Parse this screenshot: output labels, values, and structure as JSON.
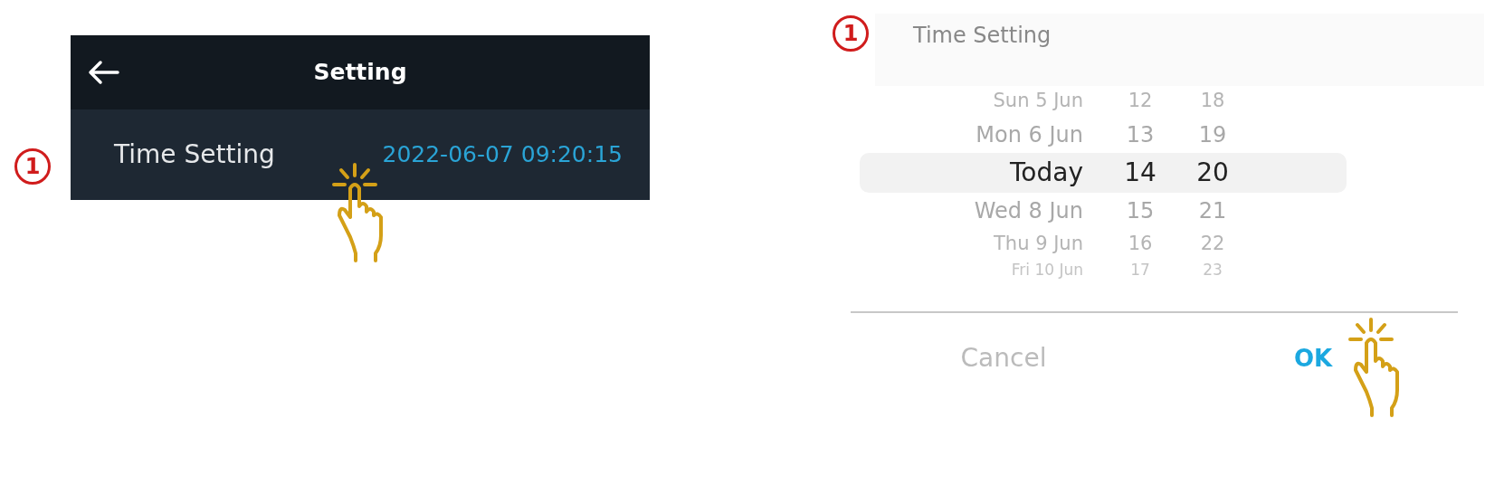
{
  "setting_screen": {
    "step": "1",
    "title": "Setting",
    "row": {
      "label": "Time Setting",
      "value": "2022-06-07 09:20:15"
    }
  },
  "time_picker": {
    "step": "1",
    "title": "Time Setting",
    "rows": [
      {
        "date": "Sun 5 Jun",
        "hour": "12",
        "minute": "18",
        "selected": false
      },
      {
        "date": "Mon 6 Jun",
        "hour": "13",
        "minute": "19",
        "selected": false
      },
      {
        "date": "Today",
        "hour": "14",
        "minute": "20",
        "selected": true
      },
      {
        "date": "Wed 8 Jun",
        "hour": "15",
        "minute": "21",
        "selected": false
      },
      {
        "date": "Thu 9 Jun",
        "hour": "16",
        "minute": "22",
        "selected": false
      },
      {
        "date": "Fri 10 Jun",
        "hour": "17",
        "minute": "23",
        "selected": false
      }
    ],
    "buttons": [
      {
        "label": "Cancel",
        "kind": "cancel"
      },
      {
        "label": "OK",
        "kind": "confirm"
      }
    ]
  }
}
